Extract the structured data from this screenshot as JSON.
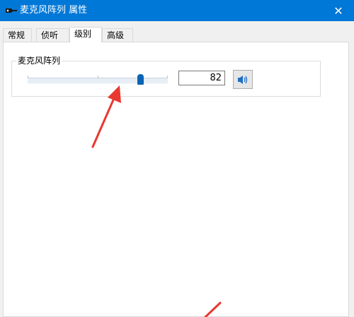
{
  "window": {
    "title": "麦克风阵列 属性",
    "close_glyph": "✕"
  },
  "tabs": [
    {
      "label": "常规",
      "active": false
    },
    {
      "label": "侦听",
      "active": false
    },
    {
      "label": "级别",
      "active": true
    },
    {
      "label": "高级",
      "active": false
    }
  ],
  "levels": {
    "group_label": "麦克风阵列",
    "value": "82",
    "slider_value": 82,
    "slider_max": 100,
    "mute_icon": "speaker-icon"
  },
  "colors": {
    "titlebar": "#0078d7",
    "slider_thumb": "#0a64b4",
    "annotation_arrow": "#e8382f"
  }
}
